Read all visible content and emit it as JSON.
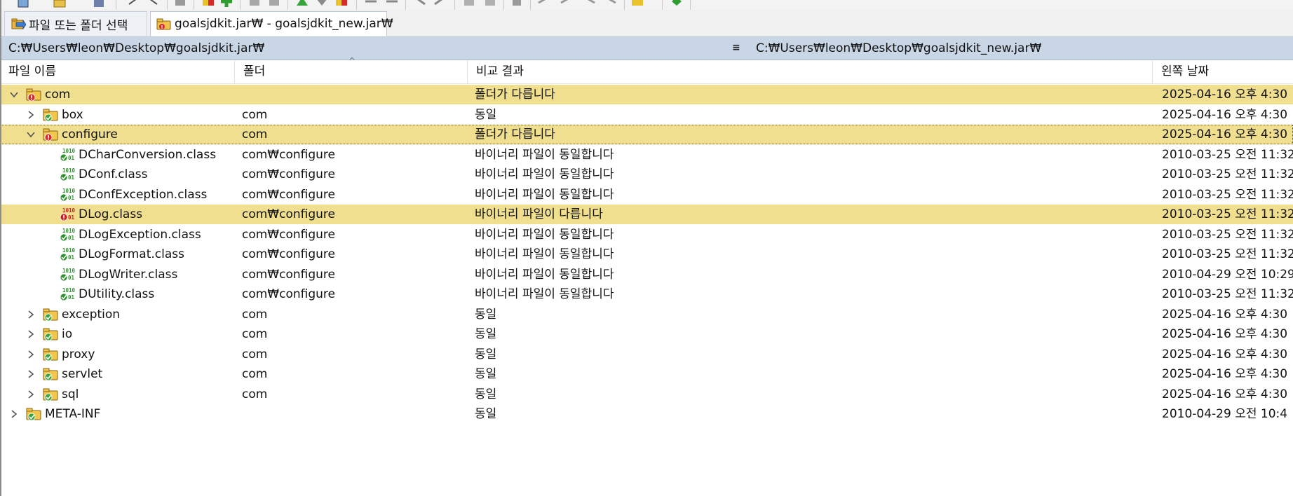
{
  "tabs": [
    {
      "label": "파일 또는 폴더 선택",
      "icon": "open-folder-icon"
    },
    {
      "label": "goalsjdkit.jar₩ - goalsjdkit_new.jar₩",
      "icon": "folder-compare-icon"
    }
  ],
  "paths": {
    "left": "C:₩Users₩leon₩Desktop₩goalsjdkit.jar₩",
    "right": "C:₩Users₩leon₩Desktop₩goalsjdkit_new.jar₩",
    "menu_glyph": "≡"
  },
  "columns": {
    "name": "파일 이름",
    "folder": "폴더",
    "result": "비교 결과",
    "left_date": "왼쪽 날짜"
  },
  "colors": {
    "highlight": "#f0df8e",
    "pathbar": "#c9d6e6",
    "folder_same": "#3aa23a",
    "folder_diff": "#d62b2b"
  },
  "rows": [
    {
      "name": "com",
      "folder": "",
      "result": "폴더가 다릅니다",
      "date": "2025-04-16 오후 4:30",
      "kind": "folder-diff",
      "level": 0,
      "expander": "expanded",
      "highlight": true,
      "focus": false
    },
    {
      "name": "box",
      "folder": "com",
      "result": "동일",
      "date": "2025-04-16 오후 4:30",
      "kind": "folder-same",
      "level": 1,
      "expander": "collapsed",
      "highlight": false,
      "focus": false
    },
    {
      "name": "configure",
      "folder": "com",
      "result": "폴더가 다릅니다",
      "date": "2025-04-16 오후 4:30",
      "kind": "folder-diff",
      "level": 1,
      "expander": "expanded",
      "highlight": true,
      "focus": true
    },
    {
      "name": "DCharConversion.class",
      "folder": "com₩configure",
      "result": "바이너리 파일이 동일합니다",
      "date": "2010-03-25 오전 11:32",
      "kind": "binary-same",
      "level": 2,
      "expander": "none",
      "highlight": false,
      "focus": false
    },
    {
      "name": "DConf.class",
      "folder": "com₩configure",
      "result": "바이너리 파일이 동일합니다",
      "date": "2010-03-25 오전 11:32",
      "kind": "binary-same",
      "level": 2,
      "expander": "none",
      "highlight": false,
      "focus": false
    },
    {
      "name": "DConfException.class",
      "folder": "com₩configure",
      "result": "바이너리 파일이 동일합니다",
      "date": "2010-03-25 오전 11:32",
      "kind": "binary-same",
      "level": 2,
      "expander": "none",
      "highlight": false,
      "focus": false
    },
    {
      "name": "DLog.class",
      "folder": "com₩configure",
      "result": "바이너리 파일이 다릅니다",
      "date": "2010-03-25 오전 11:32",
      "kind": "binary-diff",
      "level": 2,
      "expander": "none",
      "highlight": true,
      "focus": false
    },
    {
      "name": "DLogException.class",
      "folder": "com₩configure",
      "result": "바이너리 파일이 동일합니다",
      "date": "2010-03-25 오전 11:32",
      "kind": "binary-same",
      "level": 2,
      "expander": "none",
      "highlight": false,
      "focus": false
    },
    {
      "name": "DLogFormat.class",
      "folder": "com₩configure",
      "result": "바이너리 파일이 동일합니다",
      "date": "2010-03-25 오전 11:32",
      "kind": "binary-same",
      "level": 2,
      "expander": "none",
      "highlight": false,
      "focus": false
    },
    {
      "name": "DLogWriter.class",
      "folder": "com₩configure",
      "result": "바이너리 파일이 동일합니다",
      "date": "2010-04-29 오전 10:29",
      "kind": "binary-same",
      "level": 2,
      "expander": "none",
      "highlight": false,
      "focus": false
    },
    {
      "name": "DUtility.class",
      "folder": "com₩configure",
      "result": "바이너리 파일이 동일합니다",
      "date": "2010-03-25 오전 11:32",
      "kind": "binary-same",
      "level": 2,
      "expander": "none",
      "highlight": false,
      "focus": false
    },
    {
      "name": "exception",
      "folder": "com",
      "result": "동일",
      "date": "2025-04-16 오후 4:30",
      "kind": "folder-same",
      "level": 1,
      "expander": "collapsed",
      "highlight": false,
      "focus": false
    },
    {
      "name": "io",
      "folder": "com",
      "result": "동일",
      "date": "2025-04-16 오후 4:30",
      "kind": "folder-same",
      "level": 1,
      "expander": "collapsed",
      "highlight": false,
      "focus": false
    },
    {
      "name": "proxy",
      "folder": "com",
      "result": "동일",
      "date": "2025-04-16 오후 4:30",
      "kind": "folder-same",
      "level": 1,
      "expander": "collapsed",
      "highlight": false,
      "focus": false
    },
    {
      "name": "servlet",
      "folder": "com",
      "result": "동일",
      "date": "2025-04-16 오후 4:30",
      "kind": "folder-same",
      "level": 1,
      "expander": "collapsed",
      "highlight": false,
      "focus": false
    },
    {
      "name": "sql",
      "folder": "com",
      "result": "동일",
      "date": "2025-04-16 오후 4:30",
      "kind": "folder-same",
      "level": 1,
      "expander": "collapsed",
      "highlight": false,
      "focus": false
    },
    {
      "name": "META-INF",
      "folder": "",
      "result": "동일",
      "date": "2010-04-29 오전 10:4",
      "kind": "folder-same",
      "level": 0,
      "expander": "collapsed",
      "highlight": false,
      "focus": false
    }
  ]
}
